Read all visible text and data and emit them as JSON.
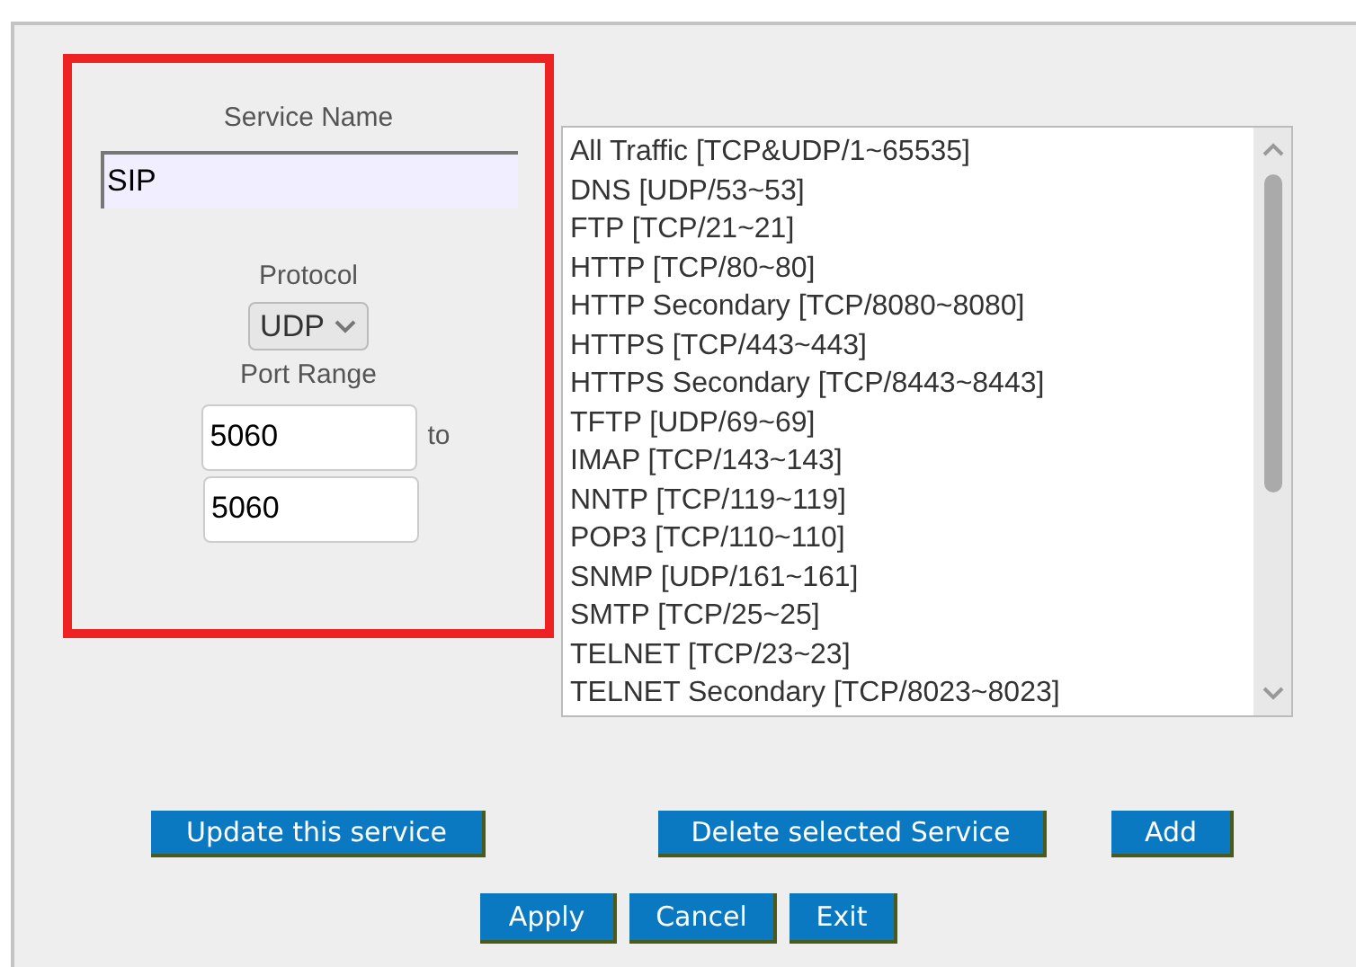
{
  "service_form": {
    "service_name_label": "Service Name",
    "service_name": "SIP",
    "protocol_label": "Protocol",
    "protocol": "UDP",
    "port_range_label": "Port Range",
    "port_from": "5060",
    "port_to_label": "to",
    "port_to": "5060"
  },
  "services": [
    {
      "label": "All Traffic [TCP&UDP/1~65535]",
      "selected": false
    },
    {
      "label": "DNS [UDP/53~53]",
      "selected": false
    },
    {
      "label": "FTP [TCP/21~21]",
      "selected": false
    },
    {
      "label": "HTTP [TCP/80~80]",
      "selected": false
    },
    {
      "label": "HTTP Secondary [TCP/8080~8080]",
      "selected": false
    },
    {
      "label": "HTTPS [TCP/443~443]",
      "selected": false
    },
    {
      "label": "HTTPS Secondary [TCP/8443~8443]",
      "selected": false
    },
    {
      "label": "TFTP [UDP/69~69]",
      "selected": false
    },
    {
      "label": "IMAP [TCP/143~143]",
      "selected": false
    },
    {
      "label": "NNTP [TCP/119~119]",
      "selected": false
    },
    {
      "label": "POP3 [TCP/110~110]",
      "selected": false
    },
    {
      "label": "SNMP [UDP/161~161]",
      "selected": false
    },
    {
      "label": "SMTP [TCP/25~25]",
      "selected": false
    },
    {
      "label": "TELNET [TCP/23~23]",
      "selected": false
    },
    {
      "label": "TELNET Secondary [TCP/8023~8023]",
      "selected": false
    }
  ],
  "service_buttons": [
    "Update this service",
    "Delete selected Service",
    "Add"
  ],
  "dialog_buttons": [
    "Apply",
    "Cancel",
    "Exit"
  ]
}
